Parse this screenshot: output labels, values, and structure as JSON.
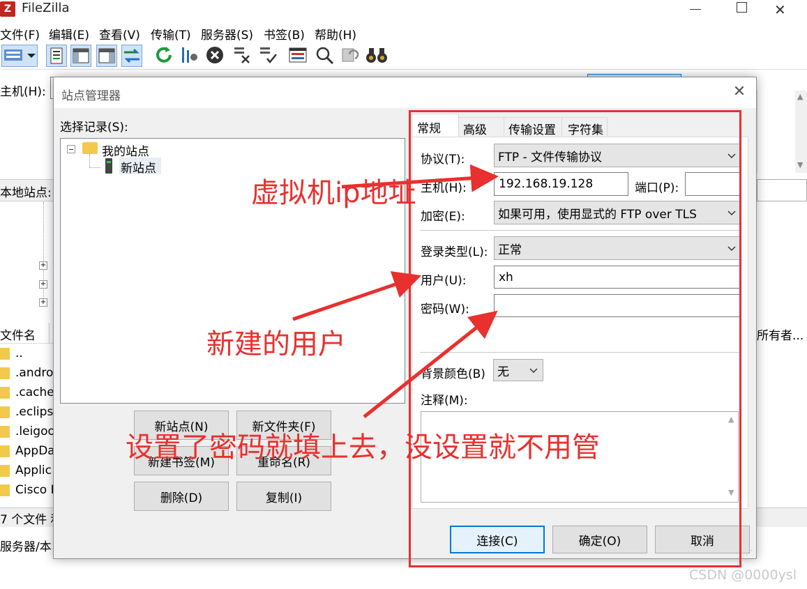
{
  "app": {
    "title": "FileZilla",
    "menu": [
      "文件(F)",
      "编辑(E)",
      "查看(V)",
      "传输(T)",
      "服务器(S)",
      "书签(B)",
      "帮助(H)"
    ],
    "quickconnect_host_label": "主机(H):",
    "local_site_label": "本地站点:",
    "local_files_header": "文件名",
    "local_files": [
      "..",
      ".andro",
      ".cache",
      ".eclips",
      ".leigoo",
      "AppDa",
      "Applic",
      "Cisco I"
    ],
    "remote_owner_header": "所有者...",
    "local_status": "7 个文件 和",
    "queue_label": "服务器/本"
  },
  "dialog": {
    "title": "站点管理器",
    "select_entry_label": "选择记录(S):",
    "tree": {
      "root": "我的站点",
      "child": "新站点"
    },
    "buttons": {
      "new_site": "新站点(N)",
      "new_folder": "新文件夹(F)",
      "new_bookmark": "新建书签(M)",
      "rename": "重命名(R)",
      "delete": "删除(D)",
      "copy": "复制(I)",
      "connect": "连接(C)",
      "ok": "确定(O)",
      "cancel": "取消"
    },
    "tabs": [
      "常规",
      "高级",
      "传输设置",
      "字符集"
    ],
    "form": {
      "protocol_label": "协议(T):",
      "protocol_value": "FTP - 文件传输协议",
      "host_label": "主机(H):",
      "host_value": "192.168.19.128",
      "port_label": "端口(P):",
      "port_value": "",
      "encryption_label": "加密(E):",
      "encryption_value": "如果可用，使用显式的 FTP over TLS",
      "logon_type_label": "登录类型(L):",
      "logon_type_value": "正常",
      "user_label": "用户(U):",
      "user_value": "xh",
      "password_label": "密码(W):",
      "password_value": "",
      "bg_color_label": "背景颜色(B)",
      "bg_color_value": "无",
      "comments_label": "注释(M):"
    }
  },
  "annotations": {
    "vm_ip": "虚拟机ip地址",
    "new_user": "新建的用户",
    "password_note": "设置了密码就填上去，没设置就不用管",
    "color": "#e8302e"
  },
  "watermark": "CSDN @0000ysl"
}
